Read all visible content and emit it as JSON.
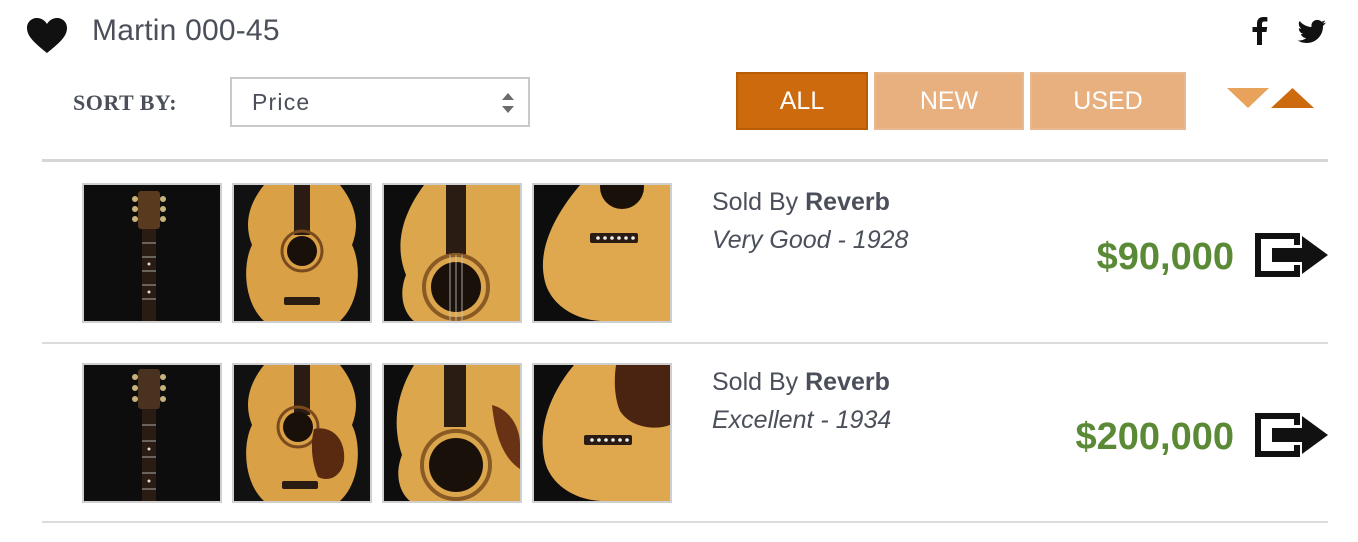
{
  "header": {
    "title": "Martin 000-45",
    "favorite_icon": "heart-icon",
    "social": [
      {
        "name": "facebook-icon"
      },
      {
        "name": "twitter-icon"
      }
    ]
  },
  "toolbar": {
    "sort_label": "SORT BY:",
    "sort_value": "Price",
    "filters": [
      {
        "label": "ALL",
        "active": true
      },
      {
        "label": "NEW",
        "active": false
      },
      {
        "label": "USED",
        "active": false
      }
    ],
    "sort_direction_icons": [
      "sort-descending-icon",
      "sort-ascending-icon"
    ]
  },
  "listings": [
    {
      "sold_by_prefix": "Sold By ",
      "seller": "Reverb",
      "condition_year": "Very Good - 1928",
      "price": "$90,000"
    },
    {
      "sold_by_prefix": "Sold By ",
      "seller": "Reverb",
      "condition_year": "Excellent - 1934",
      "price": "$200,000"
    }
  ],
  "colors": {
    "accent": "#cc6a0d",
    "accent_light": "#e8b07f",
    "price_green": "#5a8a35",
    "text": "#4a4f5a"
  }
}
